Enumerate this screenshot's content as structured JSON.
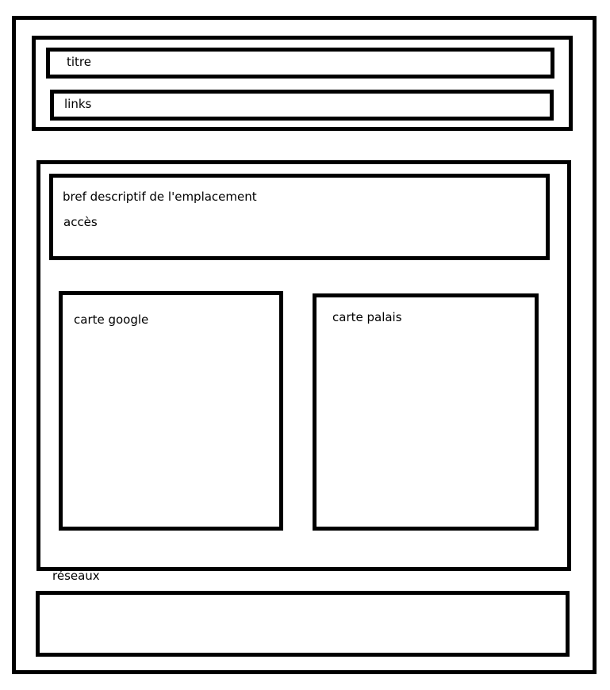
{
  "header": {
    "title_label": "titre",
    "links_label": "links"
  },
  "main": {
    "description_label": "bref descriptif de l'emplacement",
    "access_label": "accès",
    "google_map_label": "carte google",
    "palace_map_label": "carte palais"
  },
  "footer": {
    "networks_label": "réseaux"
  }
}
